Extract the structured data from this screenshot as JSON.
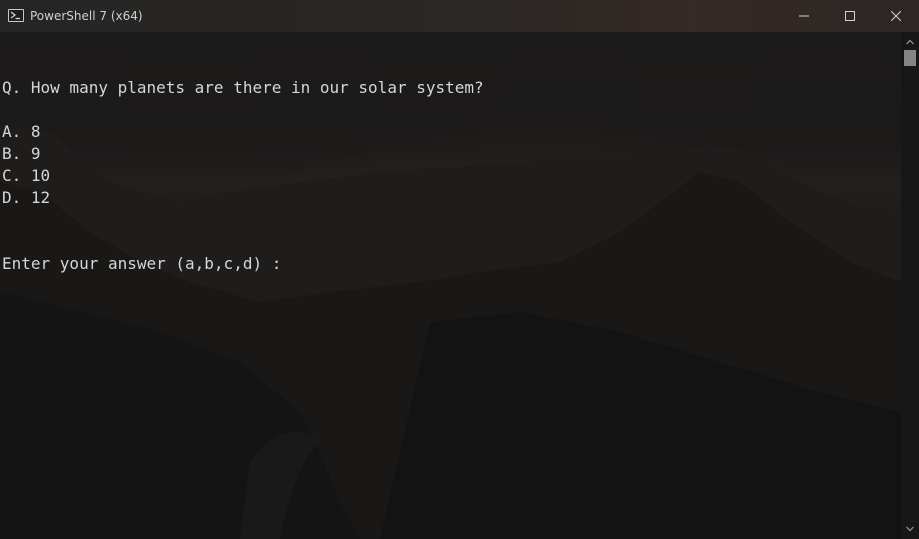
{
  "window": {
    "title": "PowerShell 7 (x64)"
  },
  "console": {
    "question": "Q. How many planets are there in our solar system?",
    "options": [
      "A. 8",
      "B. 9",
      "C. 10",
      "D. 12"
    ],
    "prompt": "Enter your answer (a,b,c,d) :"
  },
  "icons": {
    "app": "powershell-icon",
    "minimize": "minimize-icon",
    "maximize": "maximize-icon",
    "close": "close-icon",
    "scroll_up": "arrow-up-icon",
    "scroll_down": "arrow-down-icon"
  },
  "colors": {
    "text": "#d6d6d6",
    "titlebar": "#252525",
    "background": "#161616",
    "scroll_thumb": "#858585"
  }
}
